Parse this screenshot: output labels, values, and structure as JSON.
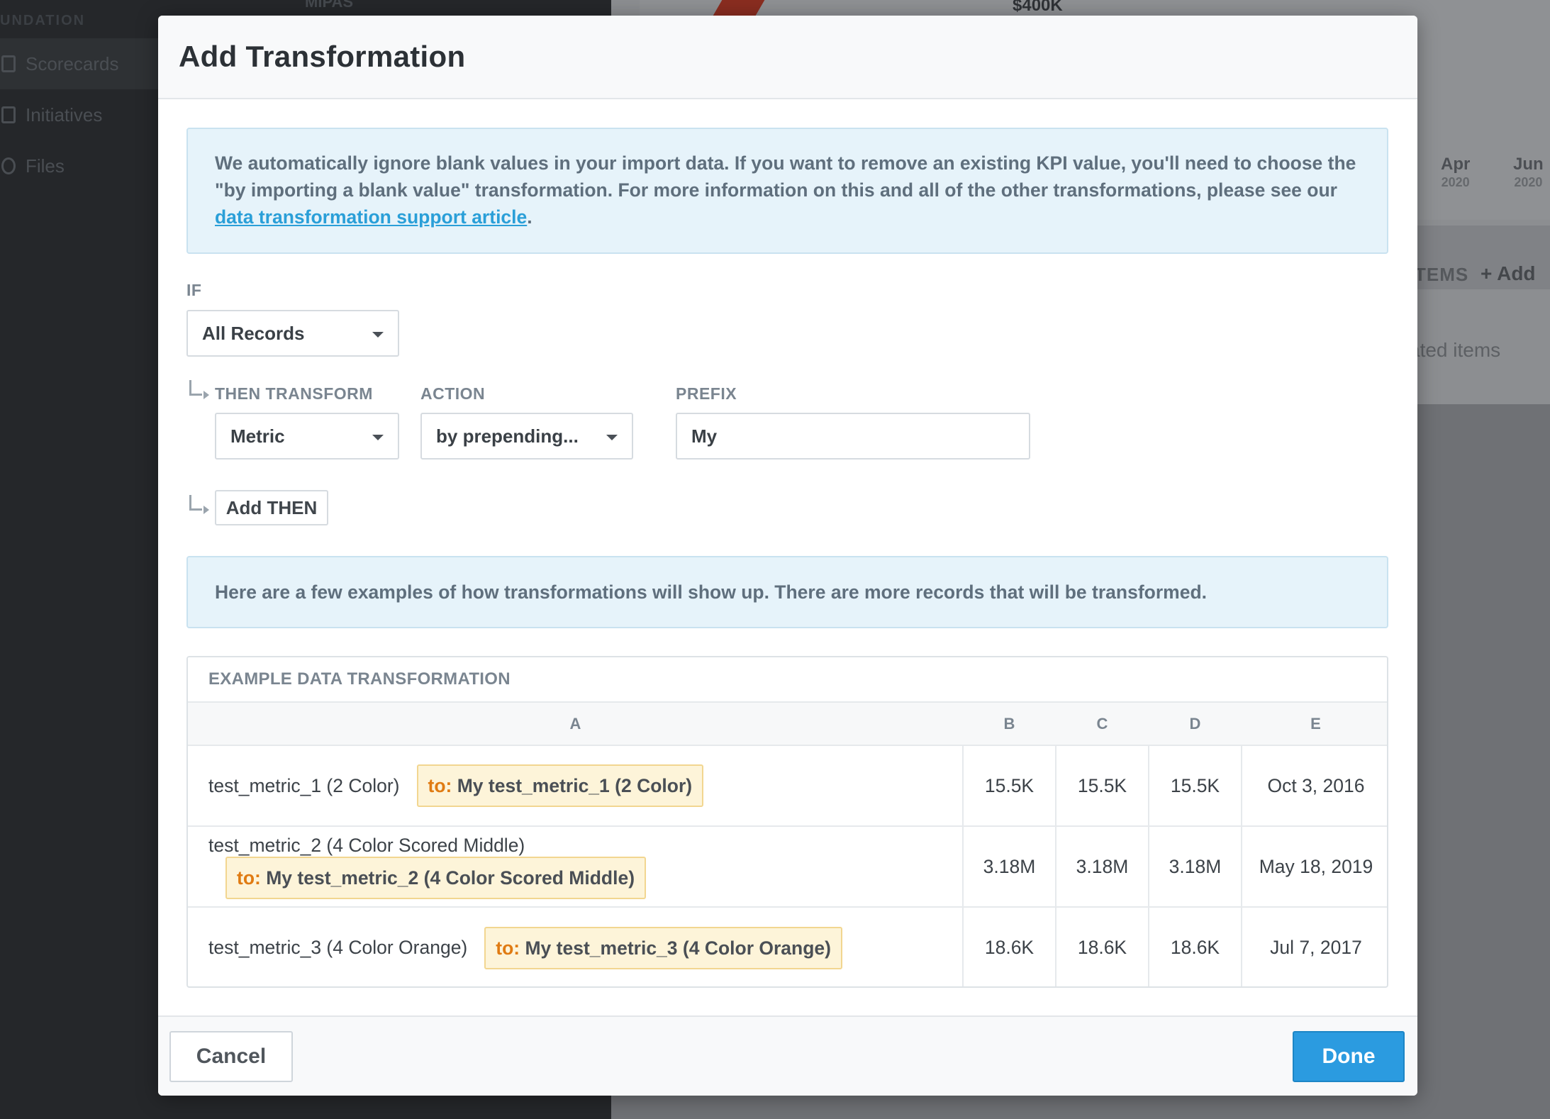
{
  "background": {
    "sidebar_section": "UNDATION",
    "sidebar_top_item": "MIPAS",
    "sidebar_items": [
      {
        "label": "Scorecards",
        "icon": "scorecard-icon"
      },
      {
        "label": "Initiatives",
        "icon": "initiative-icon"
      },
      {
        "label": "Files",
        "icon": "file-icon"
      }
    ],
    "chart_value_label": "$400K",
    "ticks": [
      {
        "month": "Apr",
        "year": "2020"
      },
      {
        "month": "Jun",
        "year": "2020"
      }
    ],
    "items_label": "TEMS",
    "add_label": "+ Add",
    "related_text": "ated items"
  },
  "modal": {
    "title": "Add Transformation",
    "info_prefix": "We automatically ignore blank values in your import data. If you want to remove an existing KPI value, you'll need to choose the \"by importing a blank value\" transformation. For more information on this and all of the other transformations, please see our ",
    "info_link": "data transformation support article",
    "info_suffix": ".",
    "if_label": "IF",
    "if_value": "All Records",
    "then_label": "THEN TRANSFORM",
    "then_value": "Metric",
    "action_label": "ACTION",
    "action_value": "by prepending...",
    "prefix_label": "PREFIX",
    "prefix_value": "My",
    "add_then_label": "Add THEN",
    "examples_note": "Here are a few examples of how transformations will show up. There are more records that will be transformed.",
    "table": {
      "caption": "EXAMPLE DATA TRANSFORMATION",
      "headers": [
        "A",
        "B",
        "C",
        "D",
        "E"
      ],
      "to_label": "to:",
      "rows": [
        {
          "a": "test_metric_1 (2 Color)",
          "a_new": "My test_metric_1 (2 Color)",
          "b": "15.5K",
          "c": "15.5K",
          "d": "15.5K",
          "e": "Oct 3, 2016"
        },
        {
          "a": "test_metric_2 (4 Color Scored Middle)",
          "a_new": "My test_metric_2 (4 Color Scored Middle)",
          "b": "3.18M",
          "c": "3.18M",
          "d": "3.18M",
          "e": "May 18, 2019"
        },
        {
          "a": "test_metric_3 (4 Color Orange)",
          "a_new": "My test_metric_3 (4 Color Orange)",
          "b": "18.6K",
          "c": "18.6K",
          "d": "18.6K",
          "e": "Jul 7, 2017"
        }
      ]
    },
    "cancel_label": "Cancel",
    "done_label": "Done"
  },
  "colors": {
    "accent": "#2b9be0",
    "link": "#2a9fd8",
    "highlight_bg": "#fdf4d9",
    "highlight_to": "#e07b12"
  }
}
